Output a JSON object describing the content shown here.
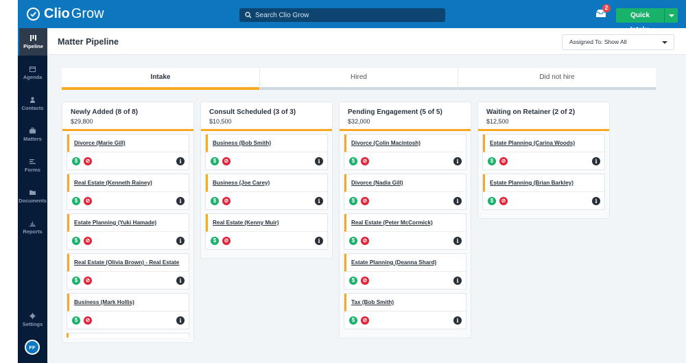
{
  "app": {
    "brand_bold": "Clio",
    "brand_light": "Grow"
  },
  "search": {
    "placeholder": "Search Clio Grow"
  },
  "notifications": {
    "count": "2"
  },
  "quick_intake": {
    "label": "Quick Intake"
  },
  "sidebar": {
    "items": [
      {
        "label": "Pipeline",
        "icon": "pipeline-icon",
        "active": true
      },
      {
        "label": "Agenda",
        "icon": "calendar-icon"
      },
      {
        "label": "Contacts",
        "icon": "person-icon"
      },
      {
        "label": "Matters",
        "icon": "briefcase-icon"
      },
      {
        "label": "Forms",
        "icon": "forms-icon"
      },
      {
        "label": "Documents",
        "icon": "folder-icon"
      },
      {
        "label": "Reports",
        "icon": "bar-chart-icon"
      }
    ],
    "settings": {
      "label": "Settings",
      "icon": "gear-icon"
    },
    "avatar": {
      "initials": "FF"
    }
  },
  "header": {
    "title": "Matter Pipeline",
    "assigned_filter": "Assigned To: Show All"
  },
  "tabs": [
    {
      "label": "Intake",
      "active": true
    },
    {
      "label": "Hired"
    },
    {
      "label": "Did not hire"
    }
  ],
  "columns": [
    {
      "title": "Newly Added (8 of 8)",
      "amount": "$29,800",
      "cards": [
        "Divorce (Marie Gill)",
        "Real Estate (Kenneth Rainey)",
        "Estate Planning (Yuki Hamade)",
        "Real Estate (Olivia Brown) - Real Estate",
        "Business (Mark Hollis)"
      ]
    },
    {
      "title": "Consult Scheduled (3 of 3)",
      "amount": "$10,500",
      "cards": [
        "Business (Bob Smith)",
        "Business (Joe Carey)",
        "Real Estate (Kenny Muir)"
      ]
    },
    {
      "title": "Pending Engagement (5 of 5)",
      "amount": "$32,000",
      "cards": [
        "Divorce (Colin Macintosh)",
        "Divorce (Nadia Gill)",
        "Real Estate (Peter McCormick)",
        "Estate Planning (Deanna Shard)",
        "Tax (Bob Smith)"
      ]
    },
    {
      "title": "Waiting on Retainer (2 of 2)",
      "amount": "$12,500",
      "cards": [
        "Estate Planning (Carina Woods)",
        "Estate Planning (Brian Barkley)"
      ]
    }
  ],
  "card_icons": {
    "dollar": "$",
    "block": "⊘",
    "info": "i"
  }
}
